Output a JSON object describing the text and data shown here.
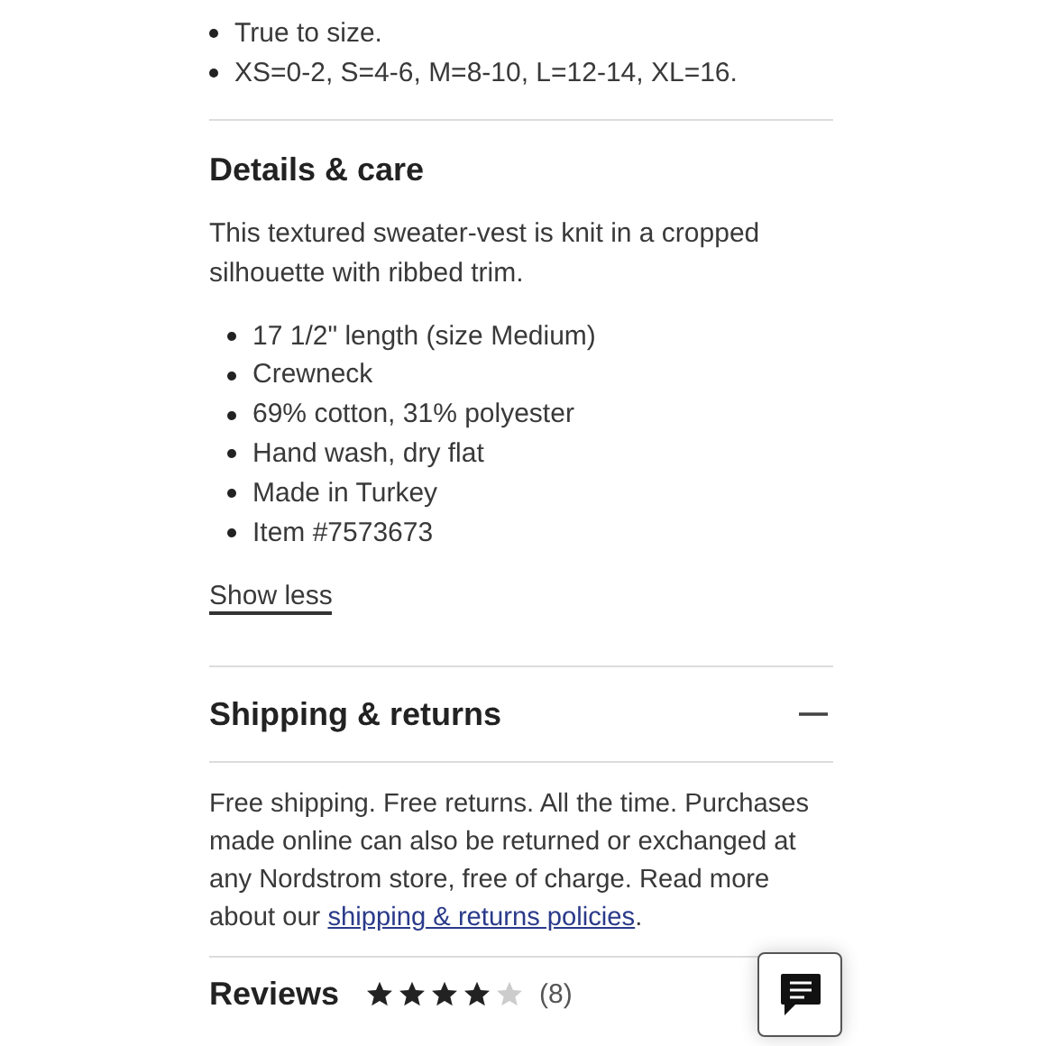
{
  "size_notes": [
    "True to size.",
    "XS=0-2, S=4-6, M=8-10, L=12-14, XL=16."
  ],
  "details": {
    "heading": "Details & care",
    "description": "This textured sweater-vest is knit in a cropped silhouette with ribbed trim.",
    "features": [
      "17 1/2\" length (size Medium)",
      "Crewneck",
      "69% cotton, 31% polyester",
      "Hand wash, dry flat",
      "Made in Turkey",
      "Item #7573673"
    ],
    "toggle": "Show less"
  },
  "sections": [
    {
      "heading": "Shipping & returns",
      "expanded": true,
      "text": "Free shipping. Free returns. All the time. Purchases made online can also be returned or exchanged at any Nordstrom store, free of charge. Read more about our ",
      "link": "shipping & returns policies",
      "after": "."
    },
    {
      "heading": "Reviews",
      "stars": 4,
      "count": "(8)"
    }
  ]
}
